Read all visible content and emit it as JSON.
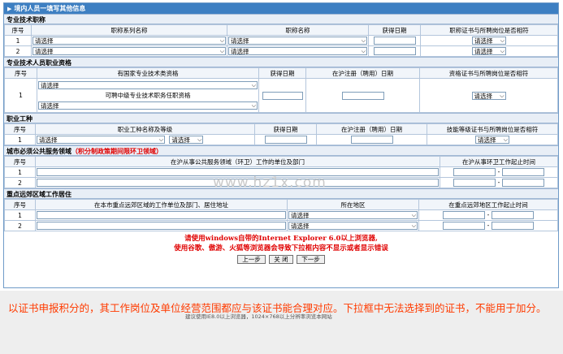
{
  "header": {
    "title": "境内人员一填写其他信息"
  },
  "sec1": {
    "title": "专业技术职称",
    "cols": [
      "序号",
      "职称系列名称",
      "职称名称",
      "获得日期",
      "职称证书与所聘岗位是否相符"
    ],
    "rows": [
      {
        "no": "1",
        "series": "请选择",
        "name": "请选择",
        "match": "请选择"
      },
      {
        "no": "2",
        "series": "请选择",
        "name": "请选择",
        "match": "请选择"
      }
    ]
  },
  "sec2": {
    "title": "专业技术人员职业资格",
    "cols": [
      "序号",
      "有国家专业技术类资格",
      "获得日期",
      "在沪注册（聘用）日期",
      "资格证书与所聘岗位是否相符"
    ],
    "row": {
      "no": "1",
      "sel_top": "请选择",
      "mid_text": "可聘中级专业技术职务任职资格",
      "sel_bottom": "请选择",
      "match": "请选择"
    }
  },
  "sec3": {
    "title": "职业工种",
    "cols": [
      "序号",
      "职业工种名称及等级",
      "获得日期",
      "在沪注册（聘用）日期",
      "技能等级证书与所聘岗位是否相符"
    ],
    "row": {
      "no": "1",
      "name": "请选择",
      "level": "请选择",
      "match": "请选择"
    }
  },
  "sec4": {
    "title": "城市必须公共服务领域",
    "title_note": "（积分制政策期间限环卫领域）",
    "cols": [
      "序号",
      "在沪从事公共服务领域（环卫）工作的单位及部门",
      "在沪从事环卫工作起止时间"
    ],
    "rows": [
      {
        "no": "1",
        "dash": "-"
      },
      {
        "no": "2",
        "dash": "-"
      }
    ]
  },
  "sec5": {
    "title": "重点远郊区域工作居住",
    "cols": [
      "序号",
      "在本市重点远郊区域的工作单位及部门、居住地址",
      "所在地区",
      "在重点远郊地区工作起止时间"
    ],
    "rows": [
      {
        "no": "1",
        "area": "请选择",
        "dash": "-"
      },
      {
        "no": "2",
        "area": "请选择",
        "dash": "-"
      }
    ]
  },
  "notice": {
    "line1": "请使用windows自带的Internet Explorer 6.0以上浏览器,",
    "line2": "使用谷歌、傲游、火狐等浏览器会导致下拉框内容不显示或者显示错误"
  },
  "buttons": {
    "prev": "上一步",
    "close": "关 闭",
    "next": "下一步"
  },
  "watermark": "www.hz1x.com",
  "footer": {
    "warning": "以证书申报积分的，其工作岗位及单位经营范围都应与该证书能合理对应。下拉框中无法选择到的证书，不能用于加分。",
    "hint": "建议使用IE8.0以上浏览器，1024×768以上分辨率浏览本网站"
  },
  "colors": {
    "title_bar": "#3d7fc2",
    "notice_red": "#e00000",
    "footer_orange": "#ff3b00"
  }
}
